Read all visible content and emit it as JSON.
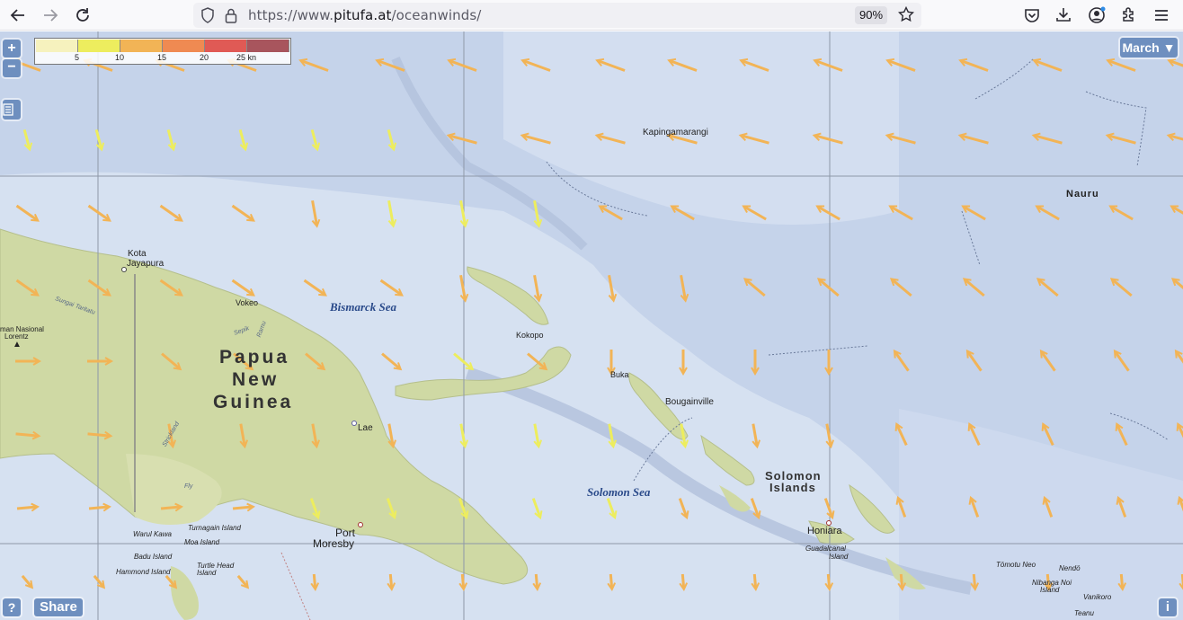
{
  "browser": {
    "url_prefix": "https://www.",
    "url_domain": "pitufa.at",
    "url_path": "/oceanwinds/",
    "zoom": "90%"
  },
  "map": {
    "month_select": "March ▼",
    "zoom_in": "+",
    "zoom_out": "−",
    "help": "?",
    "share": "Share",
    "info": "i",
    "legend": {
      "ticks": [
        "5",
        "10",
        "15",
        "20",
        "25 kn"
      ],
      "colors": [
        "#f6f2be",
        "#eded5e",
        "#f2b456",
        "#ef8a52",
        "#e05a55",
        "#a8555d"
      ]
    },
    "places": {
      "kapinga": "Kapingamarangi",
      "nauru": "Nauru",
      "kota": "Kota",
      "jayapura": "Jayapura",
      "vokeo": "Vokeo",
      "bismarck": "Bismarck Sea",
      "png1": "Papua",
      "png2": "New",
      "png3": "Guinea",
      "kokopo": "Kokopo",
      "buka": "Buka",
      "bougainville": "Bougainville",
      "lae": "Lae",
      "solomon_sea": "Solomon Sea",
      "solomon1": "Solomon",
      "solomon2": "Islands",
      "honiara": "Honiara",
      "guadalcanal1": "Guadalcanal",
      "guadalcanal2": "Island",
      "port": "Port",
      "moresby": "Moresby",
      "turnagain": "Turnagain Island",
      "warul": "Warul Kawa",
      "moa": "Moa Island",
      "badu": "Badu Island",
      "hammond": "Hammond Island",
      "turtle1": "Turtle Head",
      "turtle2": "Island",
      "lorentz1": "man Nasional",
      "lorentz2": "Lorentz",
      "sungai": "Sungai Taritatu",
      "sepik": "Sepik",
      "ramu": "Ramu",
      "strickland": "Strickland",
      "fly": "Fly",
      "tomotu": "Tōmotu Neo",
      "nendo": "Nendö",
      "nibanga1": "Nibanga Noi",
      "nibanga2": "Island",
      "vanikoro": "Vanikoro",
      "teanu": "Teanu"
    }
  }
}
